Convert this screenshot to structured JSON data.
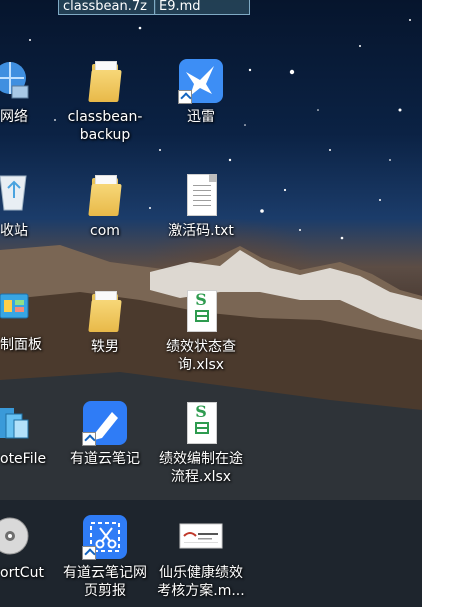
{
  "window_tabs": [
    "classbean.7z",
    "E9.md"
  ],
  "left_column": [
    {
      "label": "网络",
      "icon": "network-globe-icon"
    },
    {
      "label": "收站",
      "icon": "recycle-bin-icon"
    },
    {
      "label": "制面板",
      "icon": "control-panel-icon"
    },
    {
      "label": "oteFile",
      "icon": "onenote-icon"
    },
    {
      "label": "ortCut",
      "icon": "cd-shortcut-icon"
    }
  ],
  "icons": [
    {
      "label": "classbean-\nbackup",
      "icon": "folder-icon"
    },
    {
      "label": "迅雷",
      "icon": "xunlei-bird-icon"
    },
    {
      "label": "com",
      "icon": "folder-icon"
    },
    {
      "label": "激活码.txt",
      "icon": "text-file-icon"
    },
    {
      "label": "轶男",
      "icon": "folder-icon"
    },
    {
      "label": "绩效状态查\n询.xlsx",
      "icon": "spreadsheet-file-icon"
    },
    {
      "label": "有道云笔记",
      "icon": "youdao-note-icon"
    },
    {
      "label": "绩效编制在途\n流程.xlsx",
      "icon": "spreadsheet-file-icon"
    },
    {
      "label": "有道云笔记网\n页剪报",
      "icon": "youdao-clipper-icon"
    },
    {
      "label": "仙乐健康绩效\n考核方案.m...",
      "icon": "document-thumbnail-icon"
    }
  ],
  "colors": {
    "youdao_blue": "#2f7cf6",
    "xunlei_blue": "#3d8ef5",
    "excel_green": "#2e9b4f",
    "folder_yellow": "#e8b949"
  }
}
